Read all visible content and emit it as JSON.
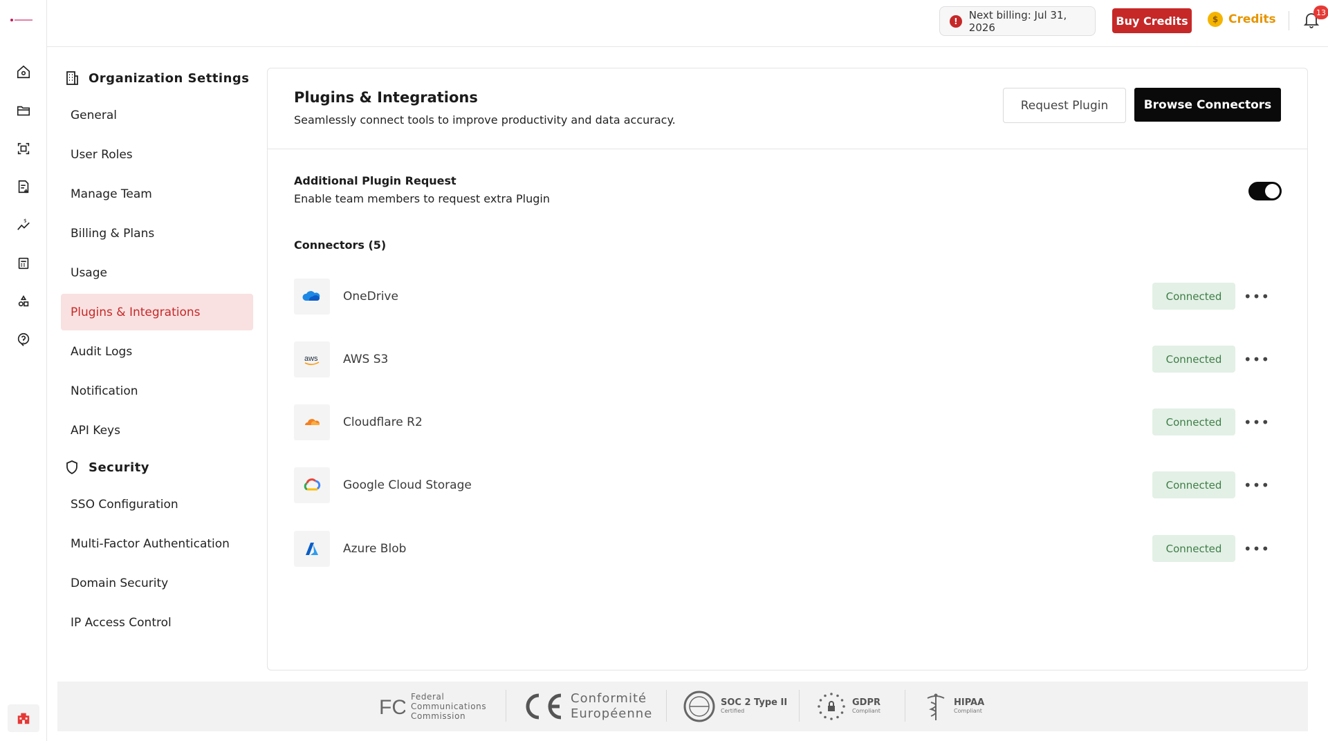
{
  "app": {
    "logo_text": "logo"
  },
  "topbar": {
    "billing_label": "Next billing: Jul 31, 2026",
    "buy_credits": "Buy Credits",
    "credits": "Credits",
    "notification_count": "13"
  },
  "nav": {
    "org_heading": "Organization Settings",
    "org_items": [
      "General",
      "User Roles",
      "Manage Team",
      "Billing & Plans",
      "Usage",
      "Plugins & Integrations",
      "Audit Logs",
      "Notification",
      "API Keys"
    ],
    "security_heading": "Security",
    "security_items": [
      "SSO Configuration",
      "Multi-Factor Authentication",
      "Domain Security",
      "IP Access Control"
    ],
    "active": "Plugins & Integrations"
  },
  "main": {
    "title": "Plugins & Integrations",
    "subtitle": "Seamlessly connect tools to improve productivity and data accuracy.",
    "request_button": "Request Plugin",
    "browse_button": "Browse Connectors",
    "request_title": "Additional Plugin Request",
    "request_sub": "Enable team members to request extra Plugin",
    "request_enabled": true,
    "connectors_title": "Connectors (5)",
    "connectors": [
      {
        "name": "OneDrive",
        "status": "Connected",
        "icon": "onedrive-icon"
      },
      {
        "name": "AWS S3",
        "status": "Connected",
        "icon": "aws-icon"
      },
      {
        "name": "Cloudflare R2",
        "status": "Connected",
        "icon": "cloudflare-icon"
      },
      {
        "name": "Google Cloud Storage",
        "status": "Connected",
        "icon": "google-cloud-icon"
      },
      {
        "name": "Azure Blob",
        "status": "Connected",
        "icon": "azure-icon"
      }
    ],
    "more_label": "•••"
  },
  "footer": {
    "fcc": [
      "Federal",
      "Communications",
      "Commission"
    ],
    "ce": [
      "Conformité",
      "Européenne"
    ],
    "soc": {
      "title": "SOC 2 Type II",
      "sub": "Certified"
    },
    "gdpr": {
      "title": "GDPR",
      "sub": "Compliant"
    },
    "hipaa": {
      "title": "HIPAA",
      "sub": "Compliant"
    }
  },
  "colors": {
    "accent_red": "#c62828",
    "active_bg": "#f9e1e1",
    "connected_bg": "#e3f0e6",
    "connected_text": "#3e7d46",
    "credits": "#e69500"
  }
}
